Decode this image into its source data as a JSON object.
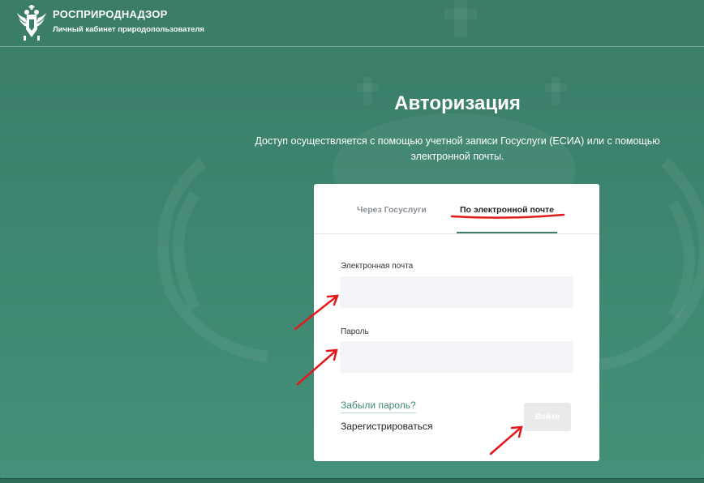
{
  "header": {
    "brand_title": "РОСПРИРОДНАДЗОР",
    "brand_subtitle": "Личный кабинет природопользователя"
  },
  "page": {
    "title": "Авторизация",
    "description": "Доступ осуществляется с помощью учетной записи Госуслуги (ЕСИА) или с помощью электронной почты."
  },
  "tabs": [
    {
      "label": "Через Госуслуги",
      "active": false
    },
    {
      "label": "По электронной почте",
      "active": true
    }
  ],
  "form": {
    "email_label": "Электронная почта",
    "email_value": "",
    "password_label": "Пароль",
    "password_value": "",
    "forgot_link": "Забыли пароль?",
    "register_link": "Зарегистрироваться",
    "login_button": "Войти"
  },
  "colors": {
    "background": "#3d8570",
    "accent": "#3b7d68",
    "annotation": "#e0191b",
    "input_bg": "#f2f4f8",
    "button_disabled": "#e8eaec"
  },
  "icons": {
    "logo": "double-headed-eagle-emblem-icon",
    "annotation": "red-arrow-icon"
  }
}
